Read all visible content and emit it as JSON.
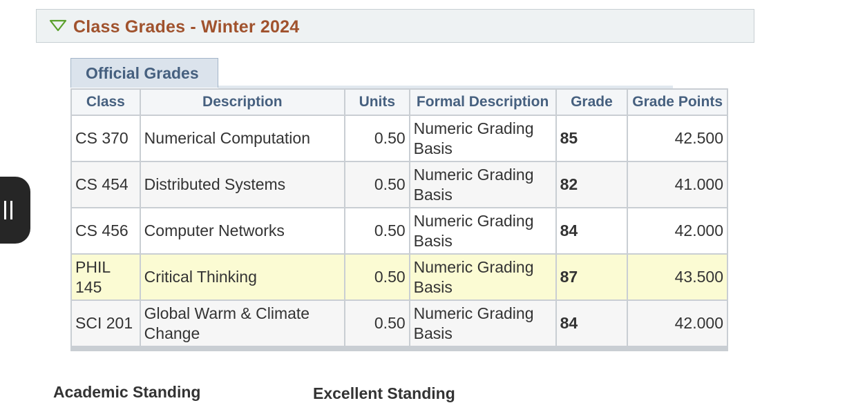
{
  "section": {
    "title": "Class Grades - Winter 2024",
    "collapse_icon": "triangle-down-icon",
    "collapse_icon_color": "#5aa02c"
  },
  "tab": {
    "label": "Official Grades"
  },
  "table": {
    "headers": {
      "class": "Class",
      "description": "Description",
      "units": "Units",
      "formal_description": "Formal Description",
      "grade": "Grade",
      "grade_points": "Grade Points"
    },
    "rows": [
      {
        "class": "CS 370",
        "description": "Numerical Computation",
        "units": "0.50",
        "formal_description": "Numeric Grading Basis",
        "grade": "85",
        "grade_points": "42.500"
      },
      {
        "class": "CS 454",
        "description": "Distributed Systems",
        "units": "0.50",
        "formal_description": "Numeric Grading Basis",
        "grade": "82",
        "grade_points": "41.000"
      },
      {
        "class": "CS 456",
        "description": "Computer Networks",
        "units": "0.50",
        "formal_description": "Numeric Grading Basis",
        "grade": "84",
        "grade_points": "42.000"
      },
      {
        "class": "PHIL 145",
        "description": "Critical Thinking",
        "units": "0.50",
        "formal_description": "Numeric Grading Basis",
        "grade": "87",
        "grade_points": "43.500"
      },
      {
        "class": "SCI 201",
        "description": "Global Warm & Climate Change",
        "units": "0.50",
        "formal_description": "Numeric Grading Basis",
        "grade": "84",
        "grade_points": "42.000"
      }
    ]
  },
  "standing": {
    "label": "Academic Standing",
    "value": "Excellent Standing"
  },
  "side_handle": {
    "icon": "pause-handle-icon"
  },
  "colors": {
    "title": "#a0522d",
    "header_text": "#46607f",
    "highlight_row": "#fbfbd3"
  }
}
